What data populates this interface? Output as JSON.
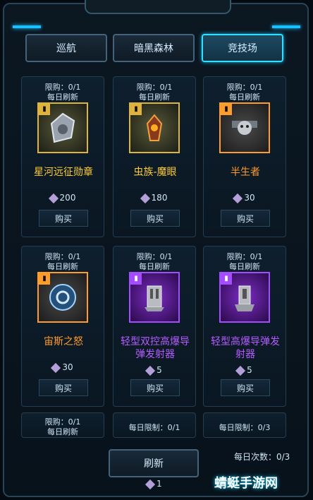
{
  "tabs": [
    {
      "label": "巡航",
      "active": false
    },
    {
      "label": "暗黑森林",
      "active": false
    },
    {
      "label": "竞技场",
      "active": true
    }
  ],
  "items": [
    {
      "limit": "限购：0/1",
      "daily": "每日刷新",
      "name": "星河远征勋章",
      "rarity": "gold",
      "price": "200",
      "buy": "购买",
      "icon": "medal-icon"
    },
    {
      "limit": "限购：0/1",
      "daily": "每日刷新",
      "name": "虫族-魔眼",
      "rarity": "gold",
      "price": "180",
      "buy": "购买",
      "icon": "eye-icon"
    },
    {
      "limit": "限购：0/1",
      "daily": "每日刷新",
      "name": "半生者",
      "rarity": "orange",
      "price": "30",
      "buy": "购买",
      "icon": "skull-icon"
    },
    {
      "limit": "限购：0/1",
      "daily": "每日刷新",
      "name": "宙斯之怒",
      "rarity": "orange",
      "price": "30",
      "buy": "购买",
      "icon": "shield-icon"
    },
    {
      "limit": "限购：0/1",
      "daily": "每日刷新",
      "name": "轻型双控高爆导弹发射器",
      "rarity": "purple",
      "price": "5",
      "buy": "购买",
      "icon": "launcher-icon"
    },
    {
      "limit": "限购：0/1",
      "daily": "每日刷新",
      "name": "轻型高爆导弹发射器",
      "rarity": "purple",
      "price": "5",
      "buy": "购买",
      "icon": "launcher-icon"
    }
  ],
  "bottom_cards": [
    {
      "line1": "限购：0/1",
      "line2": "每日刷新"
    },
    {
      "line1": "每日限制：0/1",
      "line2": ""
    },
    {
      "line1": "每日限制：0/3",
      "line2": ""
    }
  ],
  "refresh": {
    "label": "刷新",
    "cost": "1"
  },
  "daily_count": "每日次数：0/3",
  "watermark": "蜻蜓手游网",
  "colors": {
    "gold": "#ffcc33",
    "orange": "#ff9c2a",
    "purple": "#b45cff",
    "accent": "#2fe0ff"
  }
}
